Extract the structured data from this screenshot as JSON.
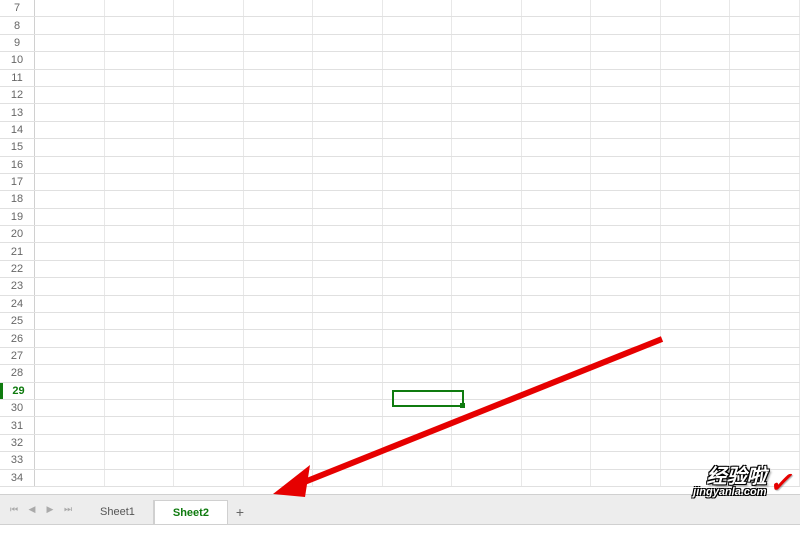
{
  "rows": {
    "start": 7,
    "end": 34,
    "active": 29
  },
  "selected_cell": {
    "row": 29,
    "col": "F"
  },
  "tabs": [
    {
      "label": "Sheet1",
      "active": false
    },
    {
      "label": "Sheet2",
      "active": true
    }
  ],
  "nav": {
    "first": "⏮",
    "prev": "◀",
    "next": "▶",
    "last": "⏭"
  },
  "add_tab": "+",
  "watermark": {
    "main": "经验啦",
    "sub": "jingyanla.com",
    "check": "✓"
  }
}
